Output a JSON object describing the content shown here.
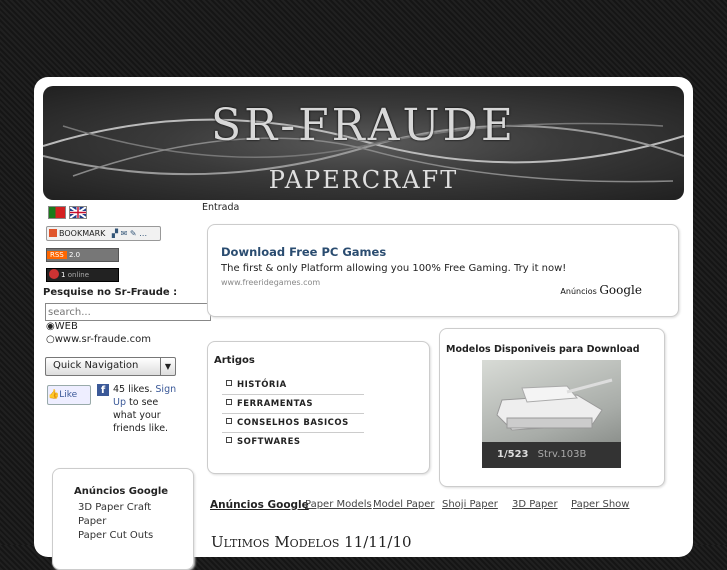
{
  "banner": {
    "title": "SR-FRAUDE",
    "subtitle": "PAPERCRAFT"
  },
  "breadcrumb": "Entrada",
  "badges": {
    "bookmark": "BOOKMARK",
    "rss": "RSS",
    "rss_version": "2.0",
    "online_count": "1",
    "online_label": "online"
  },
  "search": {
    "heading": "Pesquise no Sr-Fraude :",
    "placeholder": "search...",
    "option_web": "WEB",
    "option_site": "www.sr-fraude.com"
  },
  "quick_nav": {
    "label": "Quick Navigation"
  },
  "facebook": {
    "like_label": "Like",
    "count_text": "45 likes.",
    "signup_text": "Sign Up",
    "rest_text": "to see what your friends like."
  },
  "ad_top": {
    "title": "Download Free PC Games",
    "text": "The first & only Platform allowing you 100% Free Gaming. Try it now!",
    "url": "www.freeridegames.com",
    "provider": "Anúncios",
    "provider_brand": "Google"
  },
  "artigos": {
    "heading": "Artigos",
    "items": [
      "HISTÓRIA",
      "FERRAMENTAS",
      "CONSELHOS BASICOS",
      "SOFTWARES"
    ]
  },
  "modelos": {
    "heading": "Modelos Disponiveis para Download",
    "counter": "1/523",
    "caption": "Strv.103B"
  },
  "ads_left": {
    "heading": "Anúncios Google",
    "links": [
      "3D Paper Craft",
      "Paper",
      "Paper Cut Outs"
    ]
  },
  "ads_bottom": {
    "heading": "Anúncios Google",
    "links": [
      "Paper Models",
      "Model Paper",
      "Shoji Paper",
      "3D Paper",
      "Paper Show"
    ]
  },
  "section_title": "Ultimos Modelos 11/11/10"
}
